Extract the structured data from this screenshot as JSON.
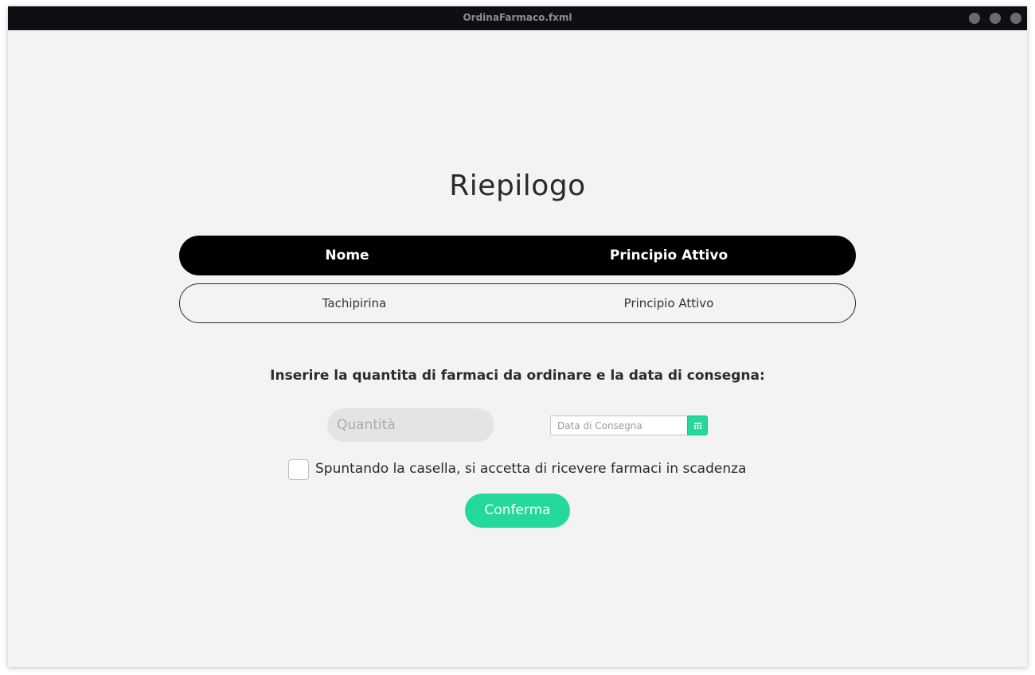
{
  "window": {
    "title": "OrdinaFarmaco.fxml"
  },
  "page": {
    "title": "Riepilogo"
  },
  "table": {
    "columns": [
      "Nome",
      "Principio Attivo"
    ],
    "rows": [
      [
        "Tachipirina",
        "Principio Attivo"
      ]
    ]
  },
  "form": {
    "instruction": "Inserire la quantita di farmaci da ordinare e la data di consegna:",
    "quantity_placeholder": "Quantità",
    "date_placeholder": "Data di Consegna",
    "checkbox_label": "Spuntando la casella, si accetta di ricevere farmaci in scadenza",
    "checkbox_checked": false,
    "confirm_label": "Conferma"
  },
  "icons": {
    "calendar": "calendar-icon"
  },
  "colors": {
    "accent": "#25d99a",
    "header_bg": "#000000",
    "titlebar_bg": "#0e0f14"
  }
}
